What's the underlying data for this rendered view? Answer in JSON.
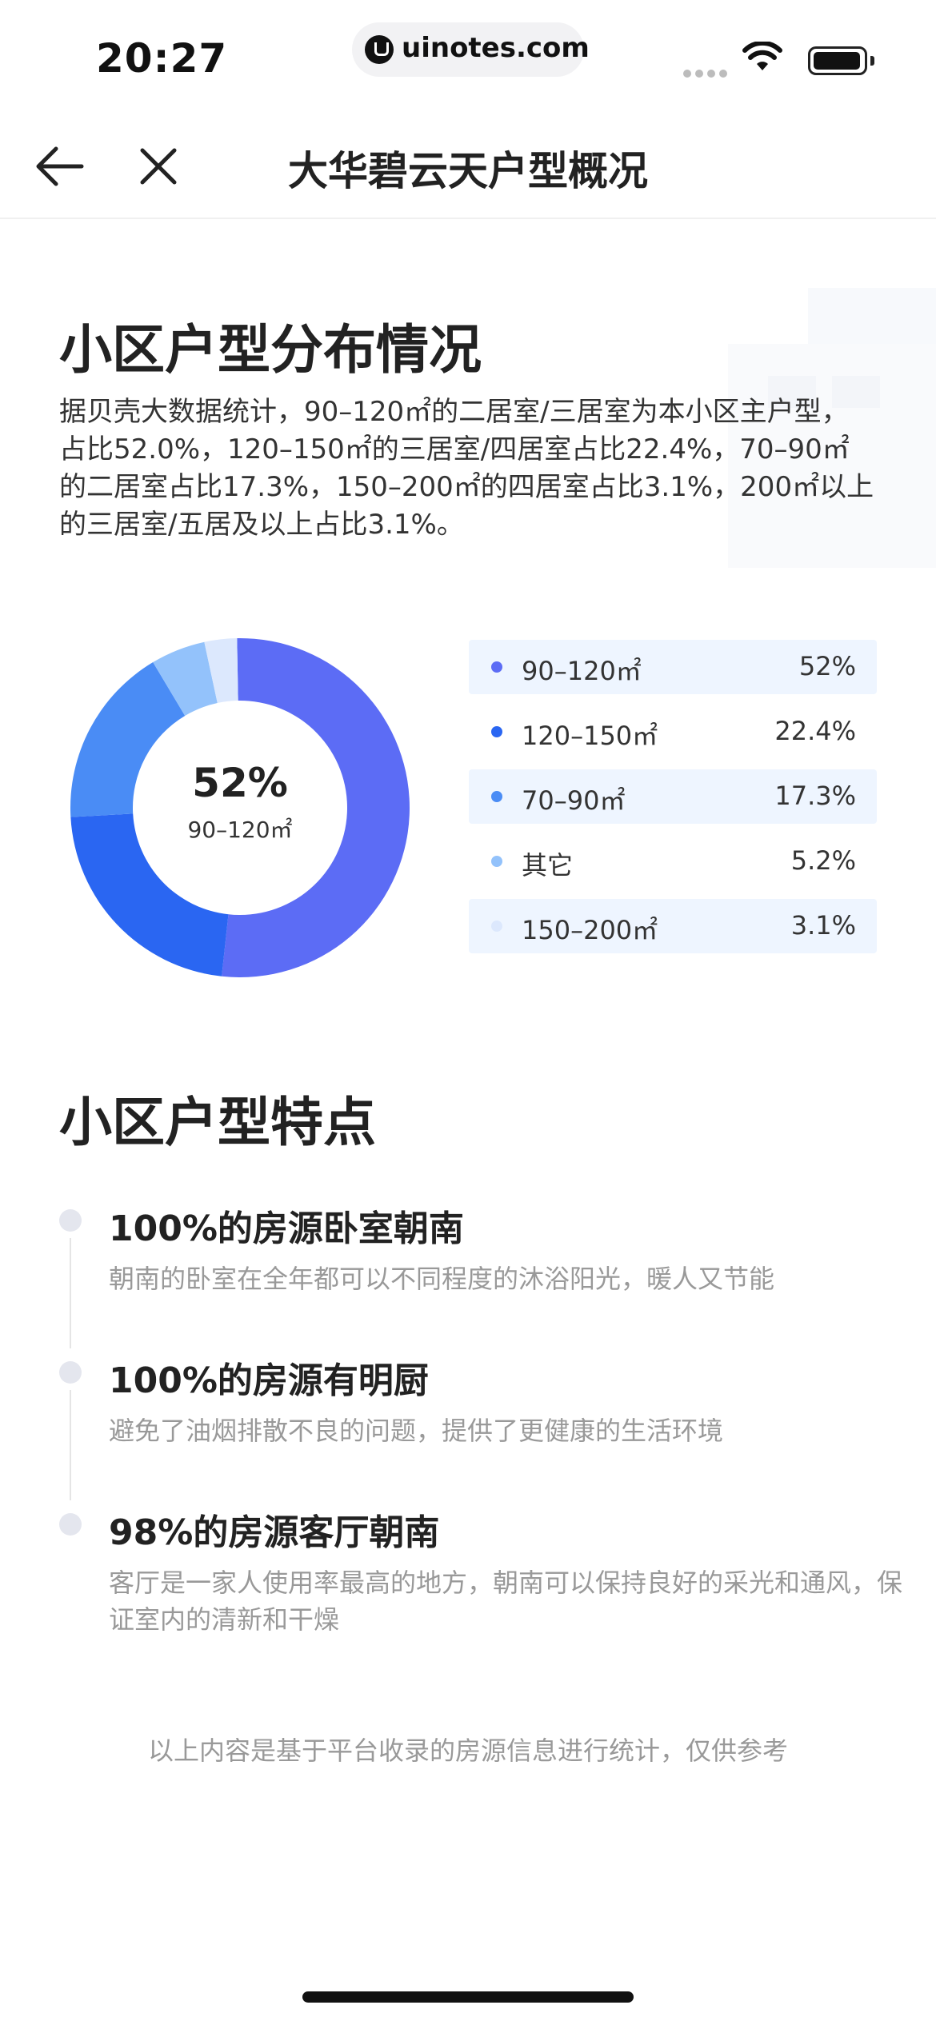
{
  "status_bar": {
    "time": "20:27",
    "url": "uinotes.com"
  },
  "nav": {
    "title": "大华碧云天户型概况"
  },
  "distribution": {
    "heading": "小区户型分布情况",
    "summary": "据贝壳大数据统计，90–120㎡的二居室/三居室为本小区主户型，占比52.0%，120–150㎡的三居室/四居室占比22.4%，70–90㎡的二居室占比17.3%，150–200㎡的四居室占比3.1%，200㎡以上的三居室/五居及以上占比3.1%。",
    "center_value": "52%",
    "center_label": "90–120㎡"
  },
  "chart_data": {
    "type": "pie",
    "variant": "donut",
    "categories": [
      "90–120㎡",
      "120–150㎡",
      "70–90㎡",
      "其它",
      "150–200㎡"
    ],
    "values": [
      52,
      22.4,
      17.3,
      5.2,
      3.1
    ],
    "value_labels": [
      "52%",
      "22.4%",
      "17.3%",
      "5.2%",
      "3.1%"
    ],
    "colors": [
      "#5c6cf5",
      "#2a66f2",
      "#4a8cf5",
      "#93c2fb",
      "#dce8fd"
    ],
    "legend_position": "right"
  },
  "features": {
    "heading": "小区户型特点",
    "items": [
      {
        "title": "100%的房源卧室朝南",
        "desc": "朝南的卧室在全年都可以不同程度的沐浴阳光，暖人又节能"
      },
      {
        "title": "100%的房源有明厨",
        "desc": "避免了油烟排散不良的问题，提供了更健康的生活环境"
      },
      {
        "title": "98%的房源客厅朝南",
        "desc": "客厅是一家人使用率最高的地方，朝南可以保持良好的采光和通风，保证室内的清新和干燥"
      }
    ]
  },
  "disclaimer": "以上内容是基于平台收录的房源信息进行统计，仅供参考"
}
